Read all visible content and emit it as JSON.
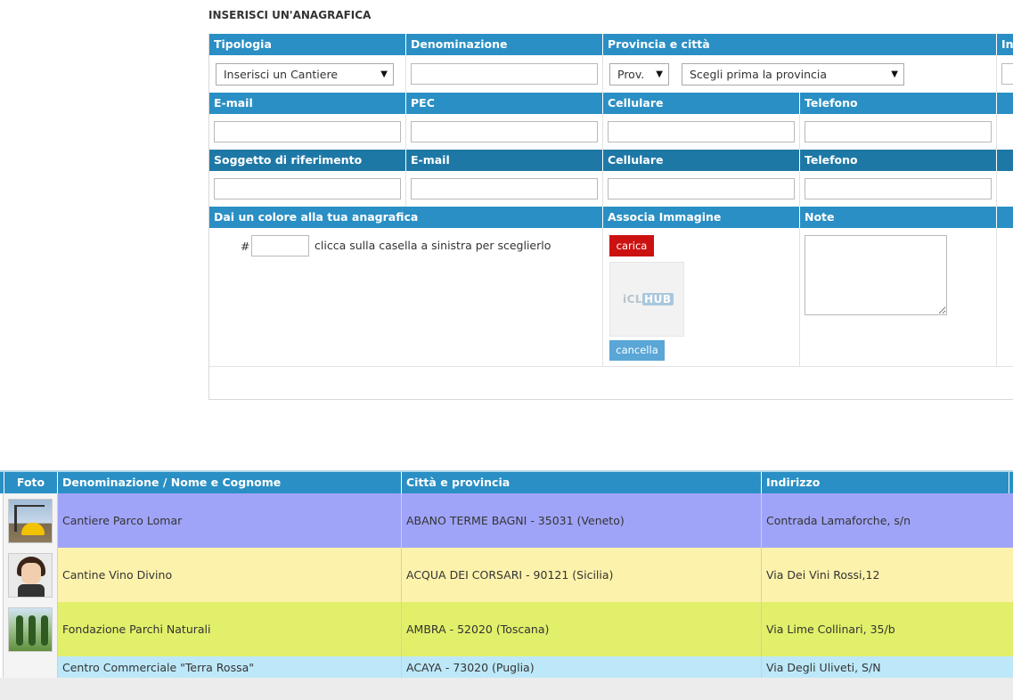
{
  "form": {
    "title": "INSERISCI UN'ANAGRAFICA",
    "headers1": {
      "tipologia": "Tipologia",
      "denominazione": "Denominazione",
      "provincia": "Provincia e città",
      "cut": "In"
    },
    "tipologia_select": "Inserisci un Cantiere",
    "prov_select": "Prov.",
    "citta_select": "Scegli prima la provincia",
    "headers2": {
      "email": "E-mail",
      "pec": "PEC",
      "cellulare": "Cellulare",
      "telefono": "Telefono"
    },
    "headers3": {
      "soggetto": "Soggetto di riferimento",
      "email": "E-mail",
      "cellulare": "Cellulare",
      "telefono": "Telefono"
    },
    "headers4": {
      "colore": "Dai un colore alla tua anagrafica",
      "immagine": "Associa Immagine",
      "note": "Note"
    },
    "hash": "#",
    "color_hint": "clicca sulla casella a sinistra per sceglierlo",
    "carica_label": "carica",
    "cancella_label": "cancella",
    "logo_left": "iCL",
    "logo_right": "HUB"
  },
  "table": {
    "headers": {
      "foto": "Foto",
      "denominazione": "Denominazione / Nome e Cognome",
      "citta": "Città e provincia",
      "indirizzo": "Indirizzo"
    },
    "rows": [
      {
        "name": "Cantiere Parco Lomar",
        "city": "ABANO TERME BAGNI - 35031 (Veneto)",
        "address": "Contrada Lamaforche, s/n",
        "color": "#a0a4f8"
      },
      {
        "name": "Cantine Vino Divino",
        "city": "ACQUA DEI CORSARI - 90121 (Sicilia)",
        "address": "Via Dei Vini Rossi,12",
        "color": "#fcf2ac"
      },
      {
        "name": "Fondazione Parchi Naturali",
        "city": "AMBRA - 52020 (Toscana)",
        "address": "Via Lime Collinari, 35/b",
        "color": "#e2ef6a"
      },
      {
        "name": "Centro Commerciale \"Terra Rossa\"",
        "city": "ACAYA - 73020 (Puglia)",
        "address": "Via Degli Uliveti, S/N",
        "color": "#bde8fa"
      }
    ]
  },
  "colors": {
    "header_blue": "#2a8fc4",
    "header_dark": "#1e78a6",
    "carica_red": "#cc1111",
    "cancella_blue": "#5aa6d6"
  }
}
